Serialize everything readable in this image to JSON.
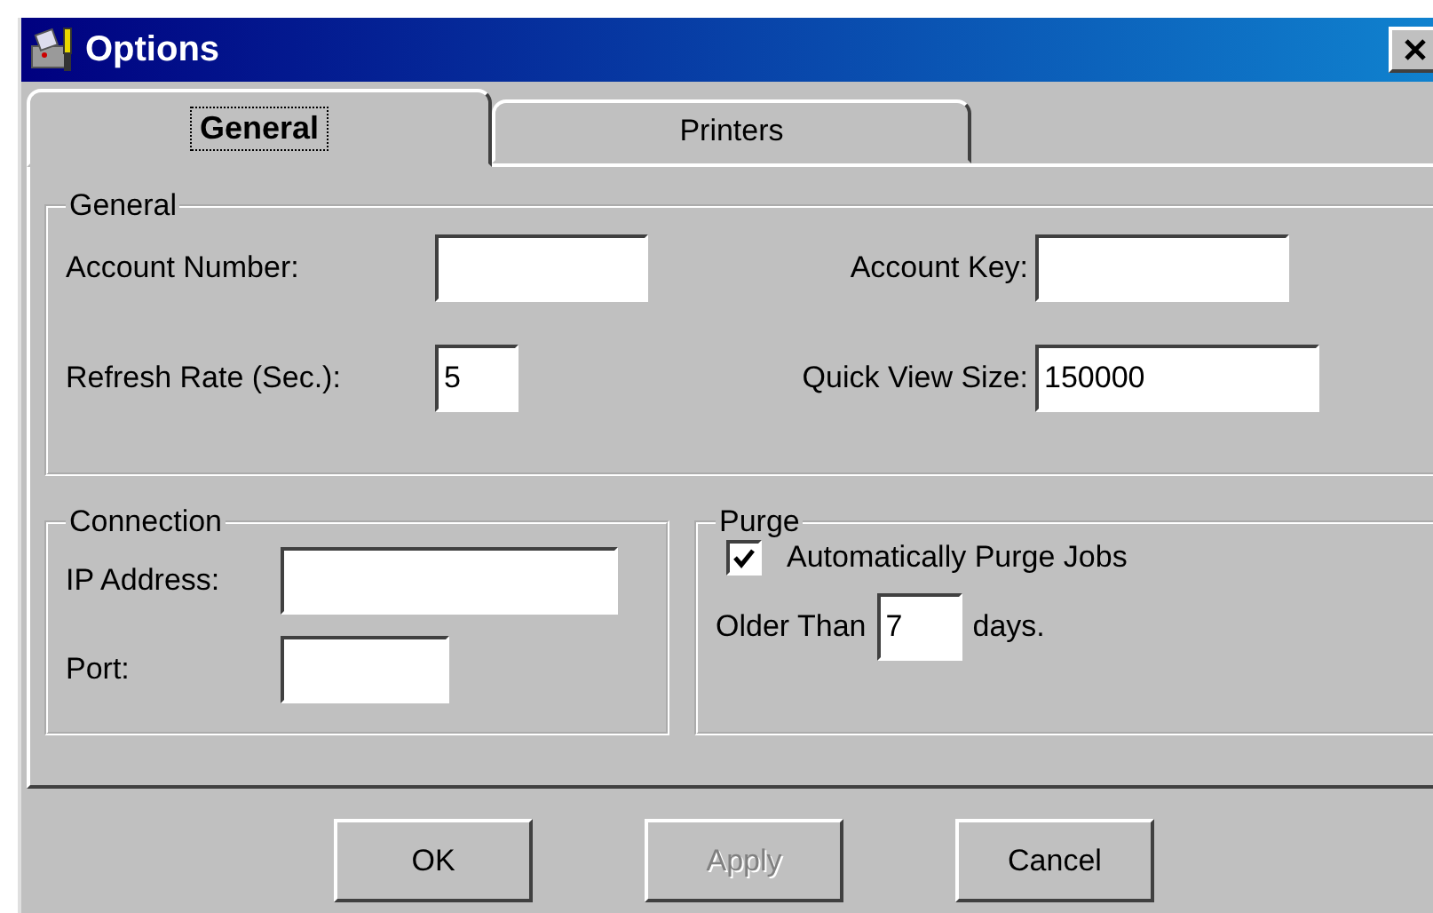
{
  "window": {
    "title": "Options"
  },
  "tabs": [
    {
      "label": "General",
      "selected": true
    },
    {
      "label": "Printers",
      "selected": false
    }
  ],
  "general": {
    "legend": "General",
    "fields": [
      {
        "label": "Account Number:"
      },
      {
        "label": "Account Key:"
      },
      {
        "label": "Refresh Rate (Sec.):",
        "value": "5"
      },
      {
        "label": "Quick View Size:",
        "value": "150000"
      }
    ]
  },
  "connection": {
    "legend": "Connection",
    "fields": [
      {
        "label": "IP Address:"
      },
      {
        "label": "Port:"
      }
    ]
  },
  "purge": {
    "legend": "Purge",
    "checkbox": {
      "label": "Automatically Purge Jobs",
      "checked": true
    },
    "older_than": {
      "label": "Older Than",
      "value": "7",
      "suffix": "days."
    }
  },
  "buttons": [
    {
      "label": "OK",
      "disabled": false
    },
    {
      "label": "Apply",
      "disabled": true
    },
    {
      "label": "Cancel",
      "disabled": false
    }
  ]
}
